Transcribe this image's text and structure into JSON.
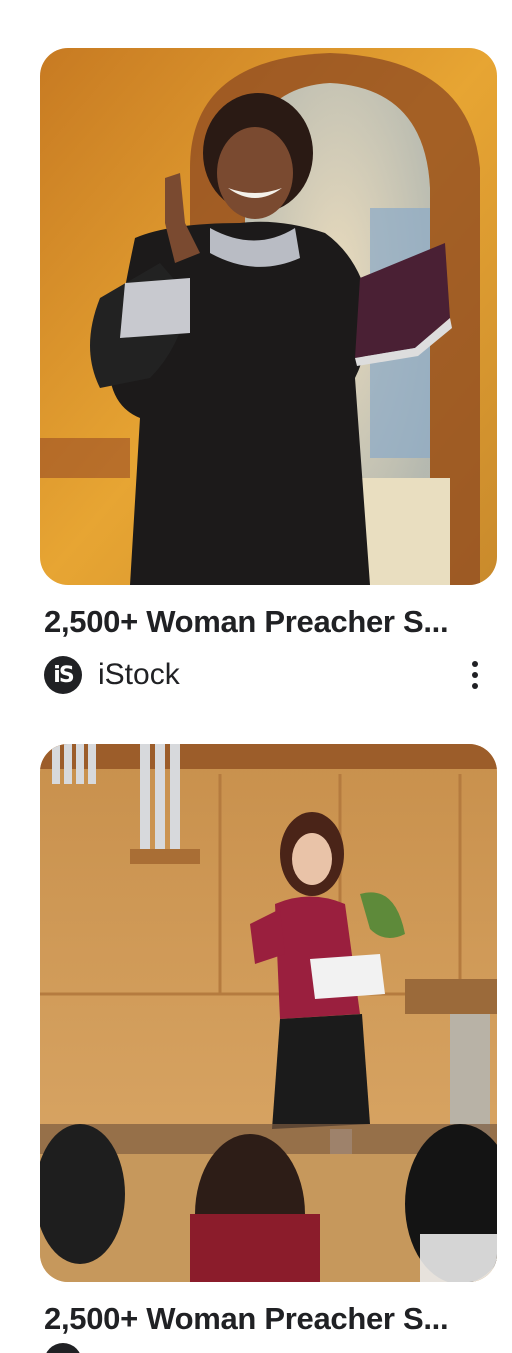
{
  "results": [
    {
      "title": "2,500+ Woman Preacher S...",
      "source": "iStock",
      "source_logo_text": "iS",
      "image_description_icon": "woman-preacher-robe-image"
    },
    {
      "title": "2,500+ Woman Preacher S...",
      "source": "",
      "image_description_icon": "woman-speaking-church-image"
    }
  ]
}
